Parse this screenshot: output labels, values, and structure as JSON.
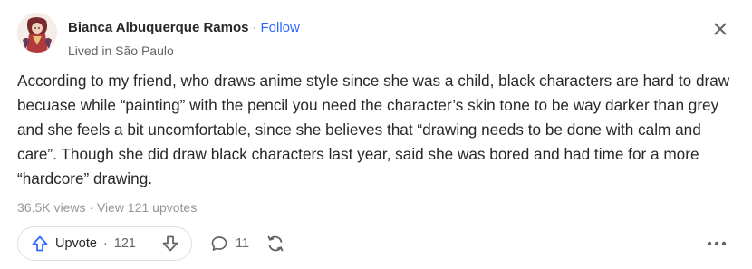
{
  "post": {
    "author": {
      "name": "Bianca Albuquerque Ramos",
      "separator": "·",
      "follow_label": "Follow",
      "credential": "Lived in São Paulo"
    },
    "body": "According to my friend, who draws anime style since she was a child, black characters are hard to draw becuase while “painting” with the pencil you need the character’s skin tone to be way darker than grey and she feels a bit uncomfortable, since she believes that “drawing needs to be done with calm and care”. Though she did draw black characters last year, said she was bored and had time for a more “hardcore” drawing.",
    "stats": {
      "views": "36.5K views",
      "separator": "·",
      "upvotes": "View 121 upvotes"
    },
    "actions": {
      "upvote_label": "Upvote",
      "upvote_separator": "·",
      "upvote_count": "121",
      "comment_count": "11"
    }
  },
  "icons": {
    "close": "close-icon",
    "upvote": "upvote-arrow-icon",
    "downvote": "downvote-arrow-icon",
    "comment": "comment-bubble-icon",
    "share": "share-cycle-icon",
    "more": "more-horizontal-icon"
  },
  "colors": {
    "accent": "#2e69ff",
    "text": "#282829",
    "muted": "#939598",
    "border": "#dee0e1"
  }
}
